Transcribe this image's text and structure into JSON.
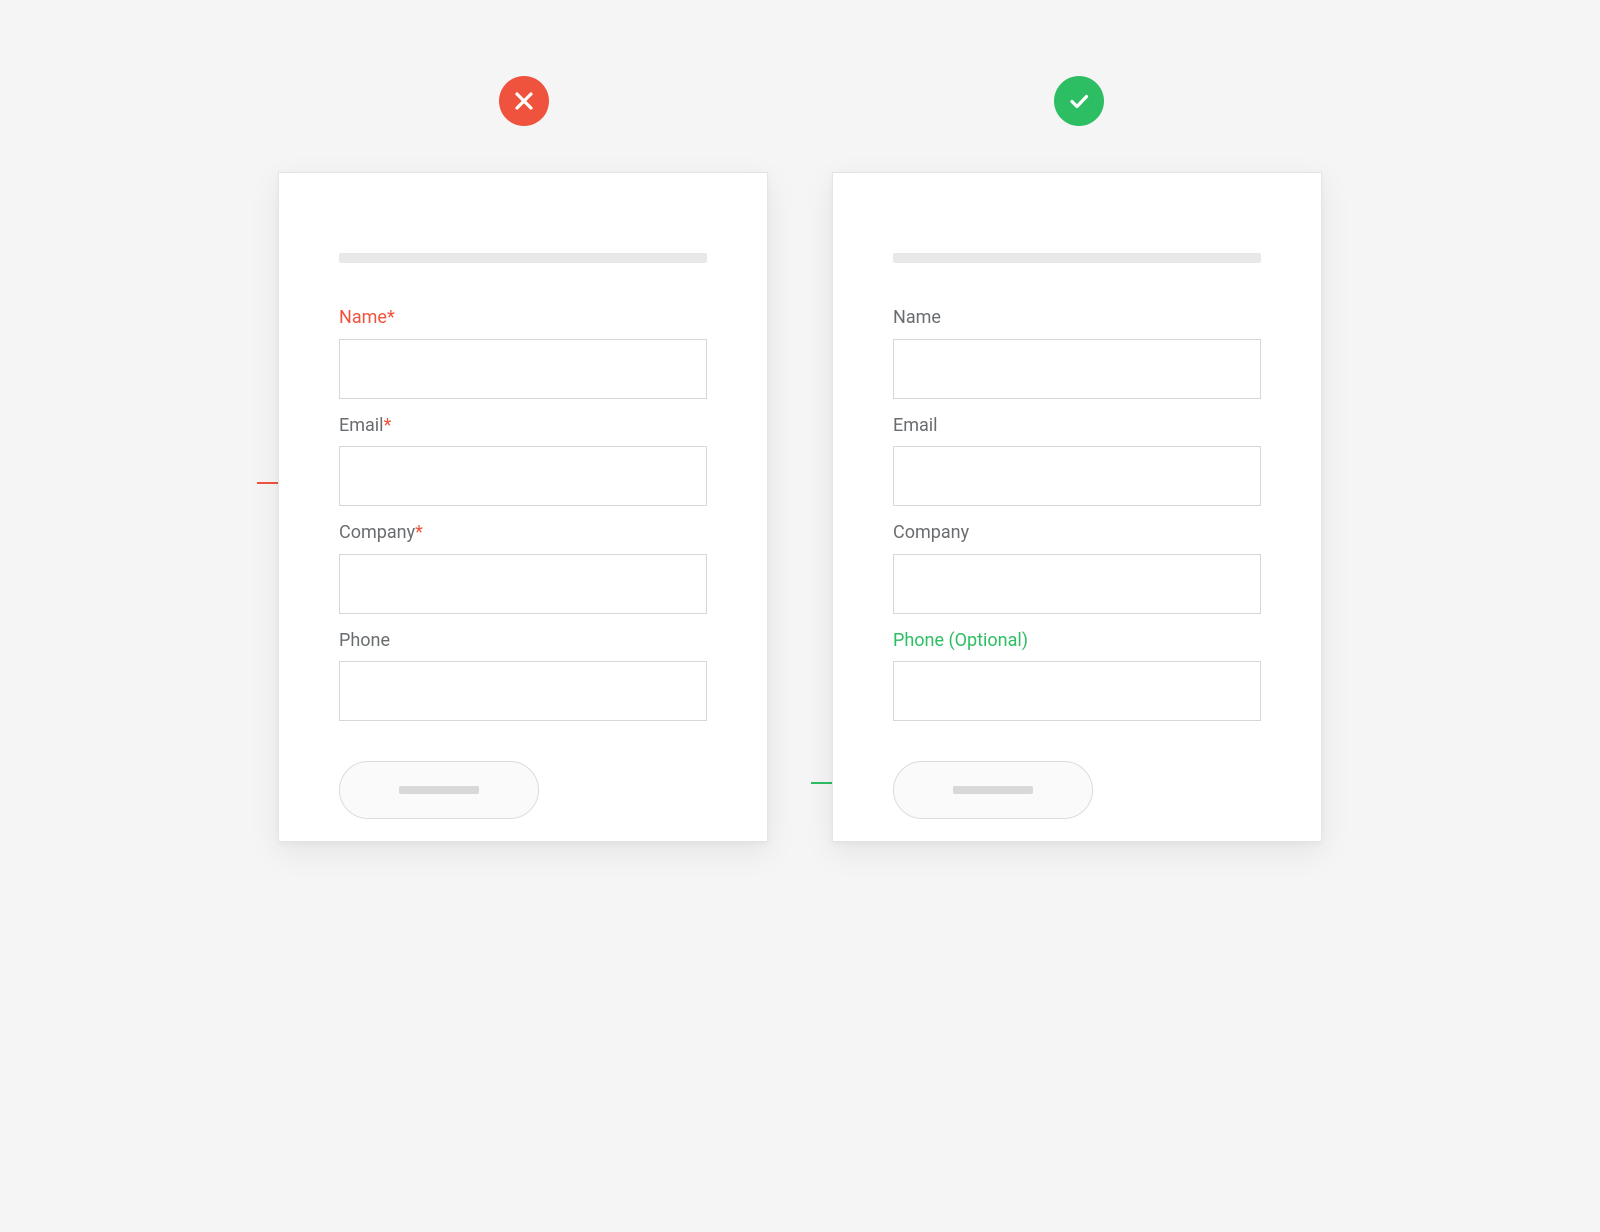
{
  "colors": {
    "bad": "#f0533d",
    "good": "#2dbe64",
    "text": "#696d70",
    "border": "#d7d7d7",
    "placeholder_bar": "#e8e8e8"
  },
  "bad_example": {
    "badge_icon": "close-icon",
    "annotation_arrow_color": "bad",
    "fields": [
      {
        "label": "Name",
        "required_asterisk": true,
        "highlight": "bad"
      },
      {
        "label": "Email",
        "required_asterisk": true,
        "highlight": null
      },
      {
        "label": "Company",
        "required_asterisk": true,
        "highlight": null
      },
      {
        "label": "Phone",
        "required_asterisk": false,
        "highlight": null
      }
    ],
    "asterisk": "*"
  },
  "good_example": {
    "badge_icon": "check-icon",
    "annotation_arrow_color": "good",
    "fields": [
      {
        "label": "Name",
        "highlight": null
      },
      {
        "label": "Email",
        "highlight": null
      },
      {
        "label": "Company",
        "highlight": null
      },
      {
        "label": "Phone (Optional)",
        "highlight": "good"
      }
    ]
  }
}
